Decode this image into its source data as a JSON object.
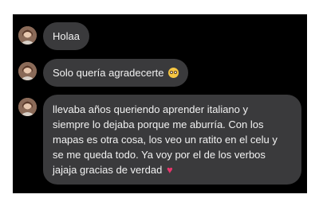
{
  "messages": [
    {
      "text": "Holaa"
    },
    {
      "text": "Solo quería agradecerte",
      "emoji": "smiling-face-with-tear-icon"
    },
    {
      "lines": [
        "llevaba años queriendo aprender italiano y",
        "siempre lo dejaba porque me aburría. Con los",
        "mapas es otra cosa, los veo un ratito en el celu y",
        "se me queda todo. Ya voy por el de los verbos",
        "jajaja gracias de verdad"
      ],
      "emoji": "pink-heart-icon"
    }
  ],
  "colors": {
    "background": "#000000",
    "bubble": "#3a3a3c",
    "text": "#f2f2f2",
    "heart": "#e8356c"
  }
}
